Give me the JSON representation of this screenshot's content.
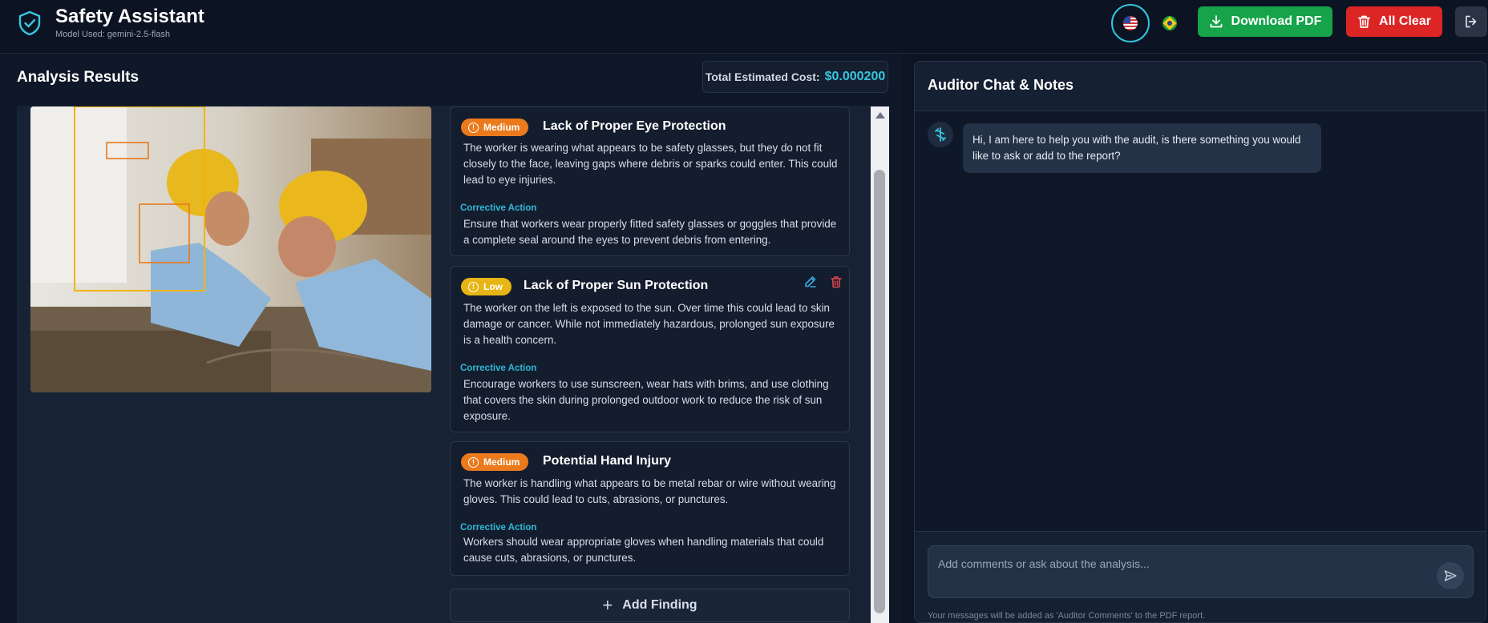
{
  "header": {
    "title": "Safety Assistant",
    "model_label": "Model Used: gemini-2.5-flash",
    "download_label": "Download PDF",
    "clear_label": "All Clear",
    "languages": [
      "en-US",
      "pt-BR"
    ]
  },
  "analysis": {
    "title": "Analysis Results",
    "cost_label": "Total Estimated Cost:",
    "cost_value": "$0.000200"
  },
  "findings": [
    {
      "severity": "Medium",
      "title": "Lack of Proper Eye Protection",
      "description": "The worker is wearing what appears to be safety glasses, but they do not fit closely to the face, leaving gaps where debris or sparks could enter. This could lead to eye injuries.",
      "corrective_label": "Corrective Action",
      "corrective_text": "Ensure that workers wear properly fitted safety glasses or goggles that provide a complete seal around the eyes to prevent debris from entering."
    },
    {
      "severity": "Low",
      "title": "Lack of Proper Sun Protection",
      "description": "The worker on the left is exposed to the sun. Over time this could lead to skin damage or cancer. While not immediately hazardous, prolonged sun exposure is a health concern.",
      "corrective_label": "Corrective Action",
      "corrective_text": "Encourage workers to use sunscreen, wear hats with brims, and use clothing that covers the skin during prolonged outdoor work to reduce the risk of sun exposure."
    },
    {
      "severity": "Medium",
      "title": "Potential Hand Injury",
      "description": "The worker is handling what appears to be metal rebar or wire without wearing gloves. This could lead to cuts, abrasions, or punctures.",
      "corrective_label": "Corrective Action",
      "corrective_text": "Workers should wear appropriate gloves when handling materials that could cause cuts, abrasions, or punctures."
    }
  ],
  "add_finding_label": "Add Finding",
  "chat": {
    "title": "Auditor Chat & Notes",
    "messages": [
      {
        "from": "bot",
        "text": "Hi, I am here to help you with the audit, is there something you would like to ask or add to the report?"
      }
    ],
    "input_placeholder": "Add comments or ask about the analysis...",
    "footnote": "Your messages will be added as 'Auditor Comments' to the PDF report."
  },
  "colors": {
    "accent": "#38c6e0",
    "medium": "#ea7a1c",
    "low": "#e7b515",
    "download": "#16a34a",
    "clear": "#dc2626"
  },
  "icons": [
    "shield-check-icon",
    "download-icon",
    "trash-icon",
    "logout-icon",
    "alert-circle-icon",
    "edit-icon",
    "plus-icon",
    "bot-icon",
    "send-icon"
  ]
}
